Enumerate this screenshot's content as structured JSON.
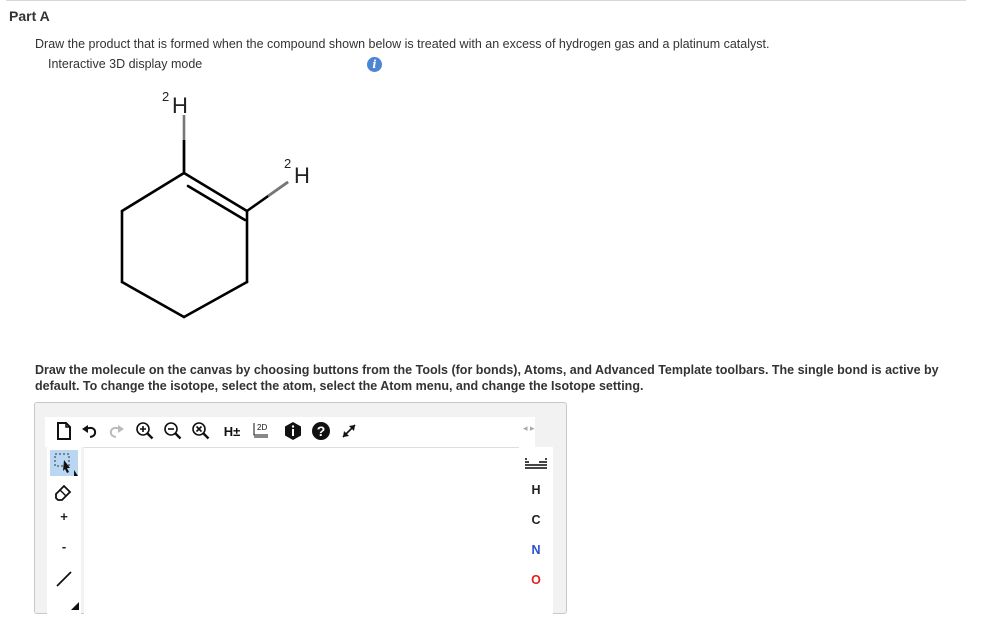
{
  "part_title": "Part A",
  "question": "Draw the product that is formed when the compound shown below is treated with an excess of hydrogen gas and a platinum catalyst.",
  "display_mode": "Interactive 3D display mode",
  "info_icon_glyph": "i",
  "molecule": {
    "label_top": {
      "sup": "2",
      "el": "H"
    },
    "label_right": {
      "sup": "2",
      "el": "H"
    }
  },
  "instructions": "Draw the molecule on the canvas by choosing buttons from the Tools (for bonds), Atoms, and Advanced Template toolbars. The single bond is active by default. To change the isotope, select the atom, select the Atom menu, and change the Isotope setting.",
  "toolbar": {
    "h_toggle": "H±",
    "label_2d": "2D",
    "help_glyph": "?",
    "nav_arrows": "◂ ▸"
  },
  "left_tools": {
    "plus": "+",
    "minus": "-"
  },
  "atoms": [
    {
      "symbol": "H",
      "color": "#333333"
    },
    {
      "symbol": "C",
      "color": "#333333"
    },
    {
      "symbol": "N",
      "color": "#2a4fd1"
    },
    {
      "symbol": "O",
      "color": "#e0201a"
    }
  ],
  "colors": {
    "info_blue": "#4a86d4",
    "select_blue": "#b9d6f2"
  }
}
